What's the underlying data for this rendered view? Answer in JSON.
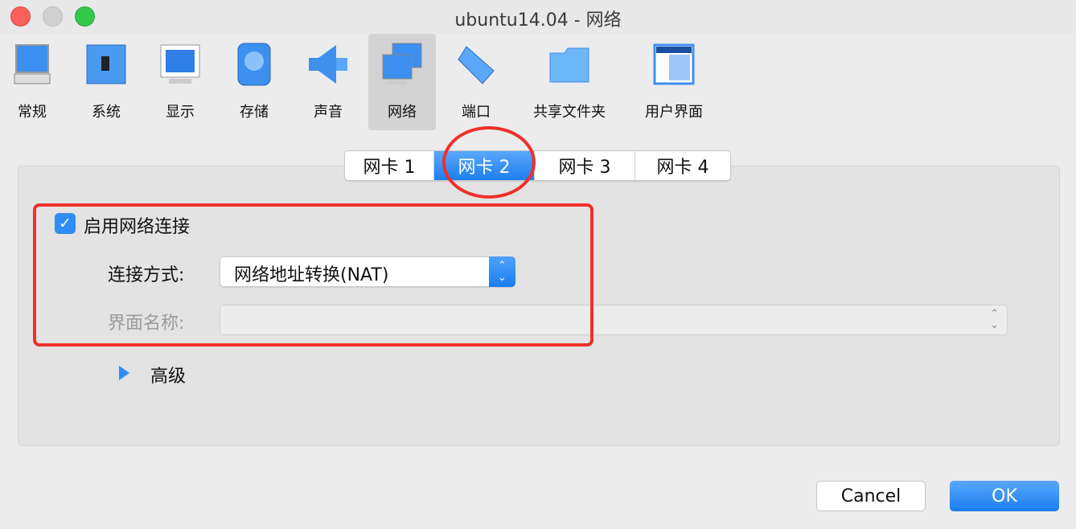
{
  "window": {
    "title": "ubuntu14.04 - 网络"
  },
  "toolbar": {
    "items": [
      {
        "label": "常规",
        "icon": "general-computer-icon"
      },
      {
        "label": "系统",
        "icon": "system-chip-icon"
      },
      {
        "label": "显示",
        "icon": "display-monitor-icon"
      },
      {
        "label": "存储",
        "icon": "storage-disk-icon"
      },
      {
        "label": "声音",
        "icon": "audio-speaker-icon"
      },
      {
        "label": "网络",
        "icon": "network-icon",
        "selected": true
      },
      {
        "label": "端口",
        "icon": "serial-port-icon"
      },
      {
        "label": "共享文件夹",
        "icon": "shared-folder-icon"
      },
      {
        "label": "用户界面",
        "icon": "user-interface-icon"
      }
    ]
  },
  "adapter_tabs": [
    "网卡 1",
    "网卡 2",
    "网卡 3",
    "网卡 4"
  ],
  "selected_tab": "网卡 2",
  "form": {
    "enable_label": "启用网络连接",
    "enabled": true,
    "attached_label": "连接方式:",
    "attached_value": "网络地址转换(NAT)",
    "name_label": "界面名称:",
    "name_value": "",
    "advanced_label": "高级"
  },
  "buttons": {
    "cancel": "Cancel",
    "ok": "OK"
  },
  "colors": {
    "accent": "#2f8df5",
    "annotation": "#f0302a"
  }
}
